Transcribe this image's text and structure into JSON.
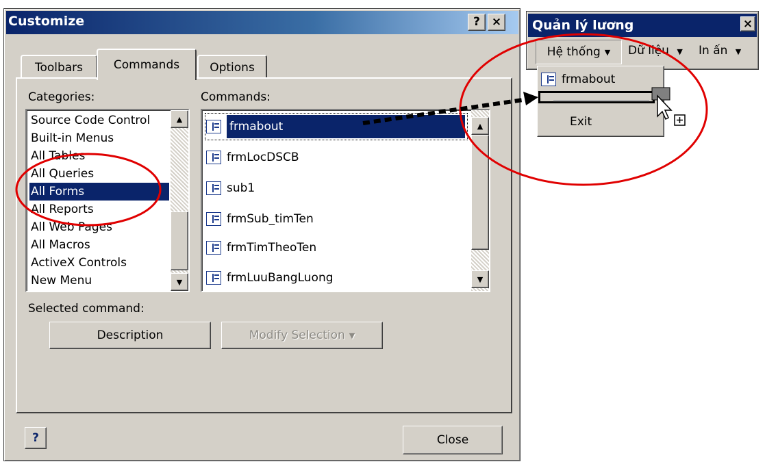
{
  "dialog": {
    "title": "Customize",
    "help_btn": "?",
    "close_btn": "×",
    "tabs": [
      {
        "label": "Toolbars"
      },
      {
        "label": "Commands"
      },
      {
        "label": "Options"
      }
    ],
    "categories_label": "Categories:",
    "commands_label": "Commands:",
    "categories": [
      "Source Code Control",
      "Built-in Menus",
      "All Tables",
      "All Queries",
      "All Forms",
      "All Reports",
      "All Web Pages",
      "All Macros",
      "ActiveX Controls",
      "New Menu"
    ],
    "selected_category": "All Forms",
    "commands": [
      "frmabout",
      "frmLocDSCB",
      "sub1",
      "frmSub_timTen",
      "frmTimTheoTen",
      "frmLuuBangLuong"
    ],
    "selected_command": "frmabout",
    "selected_command_label": "Selected command:",
    "description_btn": "Description",
    "modify_btn": "Modify Selection",
    "close_button": "Close"
  },
  "toolbar_window": {
    "title": "Quản lý lương",
    "close_btn": "×",
    "menus": [
      {
        "label": "Hệ thống"
      },
      {
        "label": "Dữ liệu"
      },
      {
        "label": "In ấn"
      }
    ],
    "dropdown_items": [
      "frmabout",
      "Exit"
    ]
  },
  "colors": {
    "highlight": "#0a246a",
    "annotation": "#e00000",
    "face": "#d4d0c8"
  }
}
